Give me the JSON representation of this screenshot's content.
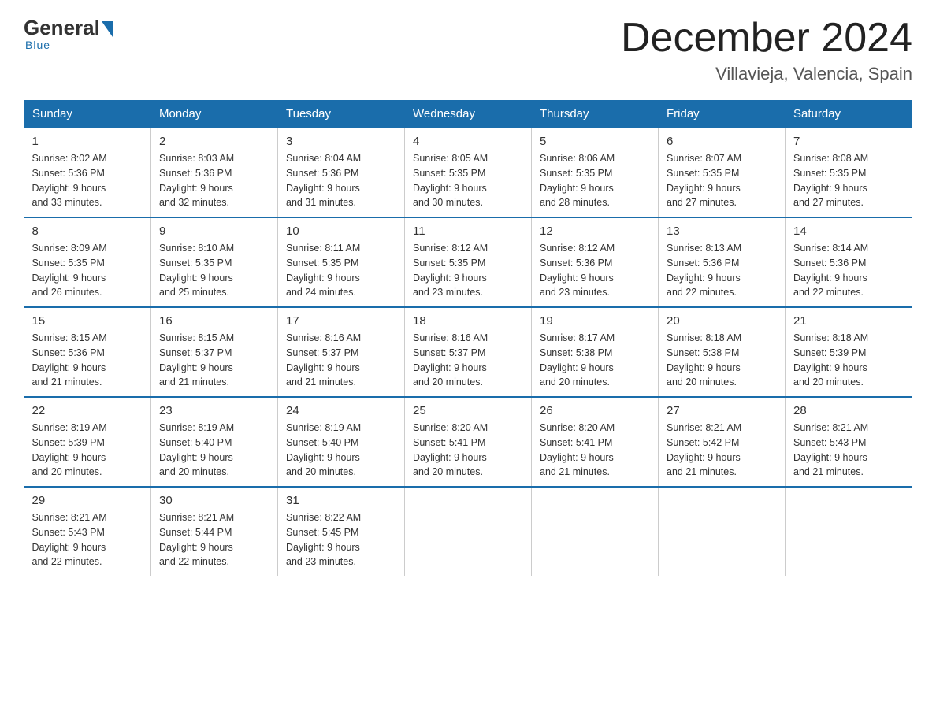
{
  "header": {
    "logo": {
      "general": "General",
      "blue": "Blue",
      "underline": "Blue"
    },
    "title": "December 2024",
    "location": "Villavieja, Valencia, Spain"
  },
  "weekdays": [
    "Sunday",
    "Monday",
    "Tuesday",
    "Wednesday",
    "Thursday",
    "Friday",
    "Saturday"
  ],
  "weeks": [
    [
      {
        "day": "1",
        "sunrise": "8:02 AM",
        "sunset": "5:36 PM",
        "daylight": "9 hours and 33 minutes."
      },
      {
        "day": "2",
        "sunrise": "8:03 AM",
        "sunset": "5:36 PM",
        "daylight": "9 hours and 32 minutes."
      },
      {
        "day": "3",
        "sunrise": "8:04 AM",
        "sunset": "5:36 PM",
        "daylight": "9 hours and 31 minutes."
      },
      {
        "day": "4",
        "sunrise": "8:05 AM",
        "sunset": "5:35 PM",
        "daylight": "9 hours and 30 minutes."
      },
      {
        "day": "5",
        "sunrise": "8:06 AM",
        "sunset": "5:35 PM",
        "daylight": "9 hours and 28 minutes."
      },
      {
        "day": "6",
        "sunrise": "8:07 AM",
        "sunset": "5:35 PM",
        "daylight": "9 hours and 27 minutes."
      },
      {
        "day": "7",
        "sunrise": "8:08 AM",
        "sunset": "5:35 PM",
        "daylight": "9 hours and 27 minutes."
      }
    ],
    [
      {
        "day": "8",
        "sunrise": "8:09 AM",
        "sunset": "5:35 PM",
        "daylight": "9 hours and 26 minutes."
      },
      {
        "day": "9",
        "sunrise": "8:10 AM",
        "sunset": "5:35 PM",
        "daylight": "9 hours and 25 minutes."
      },
      {
        "day": "10",
        "sunrise": "8:11 AM",
        "sunset": "5:35 PM",
        "daylight": "9 hours and 24 minutes."
      },
      {
        "day": "11",
        "sunrise": "8:12 AM",
        "sunset": "5:35 PM",
        "daylight": "9 hours and 23 minutes."
      },
      {
        "day": "12",
        "sunrise": "8:12 AM",
        "sunset": "5:36 PM",
        "daylight": "9 hours and 23 minutes."
      },
      {
        "day": "13",
        "sunrise": "8:13 AM",
        "sunset": "5:36 PM",
        "daylight": "9 hours and 22 minutes."
      },
      {
        "day": "14",
        "sunrise": "8:14 AM",
        "sunset": "5:36 PM",
        "daylight": "9 hours and 22 minutes."
      }
    ],
    [
      {
        "day": "15",
        "sunrise": "8:15 AM",
        "sunset": "5:36 PM",
        "daylight": "9 hours and 21 minutes."
      },
      {
        "day": "16",
        "sunrise": "8:15 AM",
        "sunset": "5:37 PM",
        "daylight": "9 hours and 21 minutes."
      },
      {
        "day": "17",
        "sunrise": "8:16 AM",
        "sunset": "5:37 PM",
        "daylight": "9 hours and 21 minutes."
      },
      {
        "day": "18",
        "sunrise": "8:16 AM",
        "sunset": "5:37 PM",
        "daylight": "9 hours and 20 minutes."
      },
      {
        "day": "19",
        "sunrise": "8:17 AM",
        "sunset": "5:38 PM",
        "daylight": "9 hours and 20 minutes."
      },
      {
        "day": "20",
        "sunrise": "8:18 AM",
        "sunset": "5:38 PM",
        "daylight": "9 hours and 20 minutes."
      },
      {
        "day": "21",
        "sunrise": "8:18 AM",
        "sunset": "5:39 PM",
        "daylight": "9 hours and 20 minutes."
      }
    ],
    [
      {
        "day": "22",
        "sunrise": "8:19 AM",
        "sunset": "5:39 PM",
        "daylight": "9 hours and 20 minutes."
      },
      {
        "day": "23",
        "sunrise": "8:19 AM",
        "sunset": "5:40 PM",
        "daylight": "9 hours and 20 minutes."
      },
      {
        "day": "24",
        "sunrise": "8:19 AM",
        "sunset": "5:40 PM",
        "daylight": "9 hours and 20 minutes."
      },
      {
        "day": "25",
        "sunrise": "8:20 AM",
        "sunset": "5:41 PM",
        "daylight": "9 hours and 20 minutes."
      },
      {
        "day": "26",
        "sunrise": "8:20 AM",
        "sunset": "5:41 PM",
        "daylight": "9 hours and 21 minutes."
      },
      {
        "day": "27",
        "sunrise": "8:21 AM",
        "sunset": "5:42 PM",
        "daylight": "9 hours and 21 minutes."
      },
      {
        "day": "28",
        "sunrise": "8:21 AM",
        "sunset": "5:43 PM",
        "daylight": "9 hours and 21 minutes."
      }
    ],
    [
      {
        "day": "29",
        "sunrise": "8:21 AM",
        "sunset": "5:43 PM",
        "daylight": "9 hours and 22 minutes."
      },
      {
        "day": "30",
        "sunrise": "8:21 AM",
        "sunset": "5:44 PM",
        "daylight": "9 hours and 22 minutes."
      },
      {
        "day": "31",
        "sunrise": "8:22 AM",
        "sunset": "5:45 PM",
        "daylight": "9 hours and 23 minutes."
      },
      null,
      null,
      null,
      null
    ]
  ],
  "labels": {
    "sunrise": "Sunrise:",
    "sunset": "Sunset:",
    "daylight": "Daylight:"
  }
}
